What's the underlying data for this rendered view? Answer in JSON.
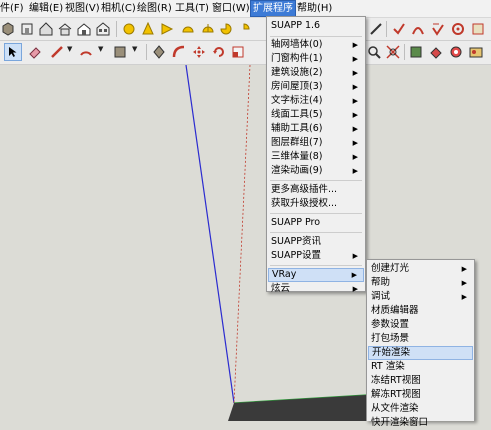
{
  "menubar": {
    "items": [
      {
        "label": "件(F)"
      },
      {
        "label": "编辑(E)"
      },
      {
        "label": "视图(V)"
      },
      {
        "label": "相机(C)"
      },
      {
        "label": "绘图(R)"
      },
      {
        "label": "工具(T)"
      },
      {
        "label": "窗口(W)"
      },
      {
        "label": "扩展程序"
      },
      {
        "label": "帮助(H)"
      }
    ]
  },
  "toolbar_top": {
    "icons": [
      "box-icon",
      "home-icon",
      "house-icon",
      "house-front-icon",
      "house-side-icon",
      "house-back-icon",
      "sphere-yellow-icon",
      "cone-icon",
      "flag-icon",
      "dome-icon",
      "dome2-icon",
      "pie-icon",
      "pie2-icon",
      "tape-icon",
      "red-check-icon",
      "red-curve-icon",
      "red-checkmark-icon",
      "red-gear-icon",
      "red-box-icon"
    ]
  },
  "toolbar_second": {
    "icons": [
      "select-icon",
      "eraser-icon",
      "pencil-icon",
      "arc-icon",
      "rectangle-icon",
      "push-pull-icon",
      "follow-me-icon",
      "move-icon",
      "rotate-icon",
      "scale-icon",
      "zoom-icon",
      "zoom-extents-icon",
      "camera-icon",
      "paint-icon",
      "section-icon",
      "component-icon"
    ]
  },
  "ext_menu": {
    "header": "SUAPP 1.6",
    "items": [
      {
        "label": "轴网墙体(0)",
        "submenu": true
      },
      {
        "label": "门窗构件(1)",
        "submenu": true
      },
      {
        "label": "建筑设施(2)",
        "submenu": true
      },
      {
        "label": "房间屋顶(3)",
        "submenu": true
      },
      {
        "label": "文字标注(4)",
        "submenu": true
      },
      {
        "label": "线面工具(5)",
        "submenu": true
      },
      {
        "label": "辅助工具(6)",
        "submenu": true
      },
      {
        "label": "图层群组(7)",
        "submenu": true
      },
      {
        "label": "三维体量(8)",
        "submenu": true
      },
      {
        "label": "渲染动画(9)",
        "submenu": true
      },
      {
        "label": "更多高级插件...",
        "submenu": false
      },
      {
        "label": "获取升级授权...",
        "submenu": false
      },
      {
        "label": "SUAPP Pro",
        "submenu": false
      },
      {
        "label": "SUAPP资讯",
        "submenu": false
      },
      {
        "label": "SUAPP设置",
        "submenu": true
      },
      {
        "label": "VRay",
        "submenu": true
      },
      {
        "label": "炫云",
        "submenu": true
      }
    ]
  },
  "vray_menu": {
    "items": [
      {
        "label": "创建灯光",
        "submenu": true
      },
      {
        "label": "帮助",
        "submenu": true
      },
      {
        "label": "调试",
        "submenu": true
      },
      {
        "label": "材质编辑器",
        "submenu": false
      },
      {
        "label": "参数设置",
        "submenu": false
      },
      {
        "label": "打包场景",
        "submenu": false
      },
      {
        "label": "开始渲染",
        "submenu": false
      },
      {
        "label": "RT 渲染",
        "submenu": false
      },
      {
        "label": "冻结RT视图",
        "submenu": false
      },
      {
        "label": "解冻RT视图",
        "submenu": false
      },
      {
        "label": "从文件渲染",
        "submenu": false
      },
      {
        "label": "快开渲染窗口",
        "submenu": false
      }
    ]
  },
  "colors": {
    "accent": "#3d7bd6",
    "highlight": "#cfe0f6",
    "axis_blue": "#2b2bd0",
    "axis_red": "#c0392b",
    "axis_green": "#2e9e3a"
  }
}
